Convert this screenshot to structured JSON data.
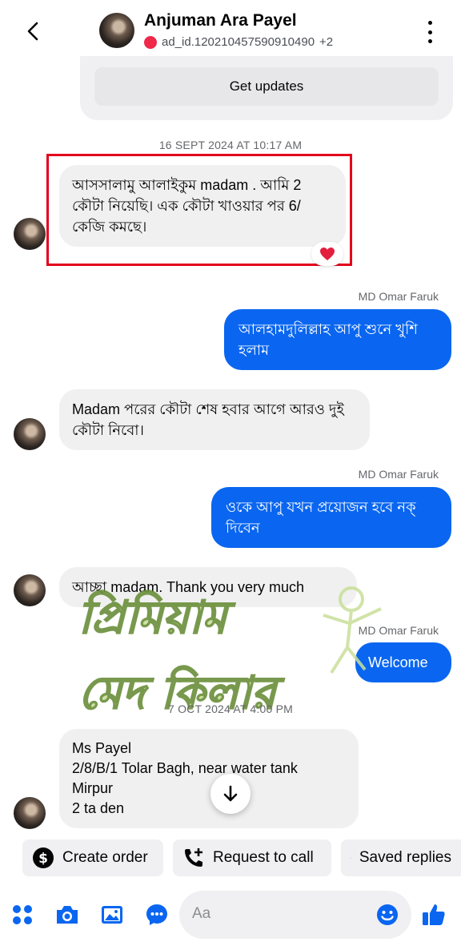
{
  "header": {
    "name": "Anjuman Ara Payel",
    "ad_id": "ad_id.120210457590910490",
    "more_count": "+2"
  },
  "updates_button": "Get updates",
  "timestamps": [
    "16 SEPT 2024 AT 10:17 AM",
    "7 OCT 2024 AT 4:00 PM"
  ],
  "messages": [
    {
      "dir": "in",
      "text": "আসসালামু আলাইকুম madam . আমি 2 কৌটা নিয়েছি। এক কৌটা খাওয়ার পর 6/ কেজি কমছে।",
      "reaction": "heart"
    },
    {
      "dir": "out",
      "sender": "MD Omar Faruk",
      "text": "আলহামদুলিল্লাহ আপু শুনে খুশি হলাম"
    },
    {
      "dir": "in",
      "text": "Madam পরের কৌটা শেষ হবার আগে আরও দুই কৌটা নিবো।"
    },
    {
      "dir": "out",
      "sender": "MD Omar Faruk",
      "text": "ওকে আপু যখন প্রয়োজন হবে নক্ দিবেন"
    },
    {
      "dir": "in",
      "text": "আচ্ছা madam. Thank you very much"
    },
    {
      "dir": "out",
      "sender": "MD Omar Faruk",
      "text": "Welcome"
    },
    {
      "dir": "in",
      "lines": [
        "Ms Payel",
        "2/8/B/1 Tolar Bagh, near  water tank",
        "Mirpur",
        "2 ta den"
      ]
    }
  ],
  "watermark": {
    "line1": "প্রিমিয়াম",
    "line2": "মেদ কিলার",
    "color": "#c9df9a"
  },
  "quick_actions": [
    "Create order",
    "Request to call",
    "Saved replies"
  ],
  "composer": {
    "placeholder": "Aa"
  },
  "colors": {
    "accent": "#0a66f0",
    "highlight": "#e3001b",
    "heart": "#e41e3f"
  }
}
